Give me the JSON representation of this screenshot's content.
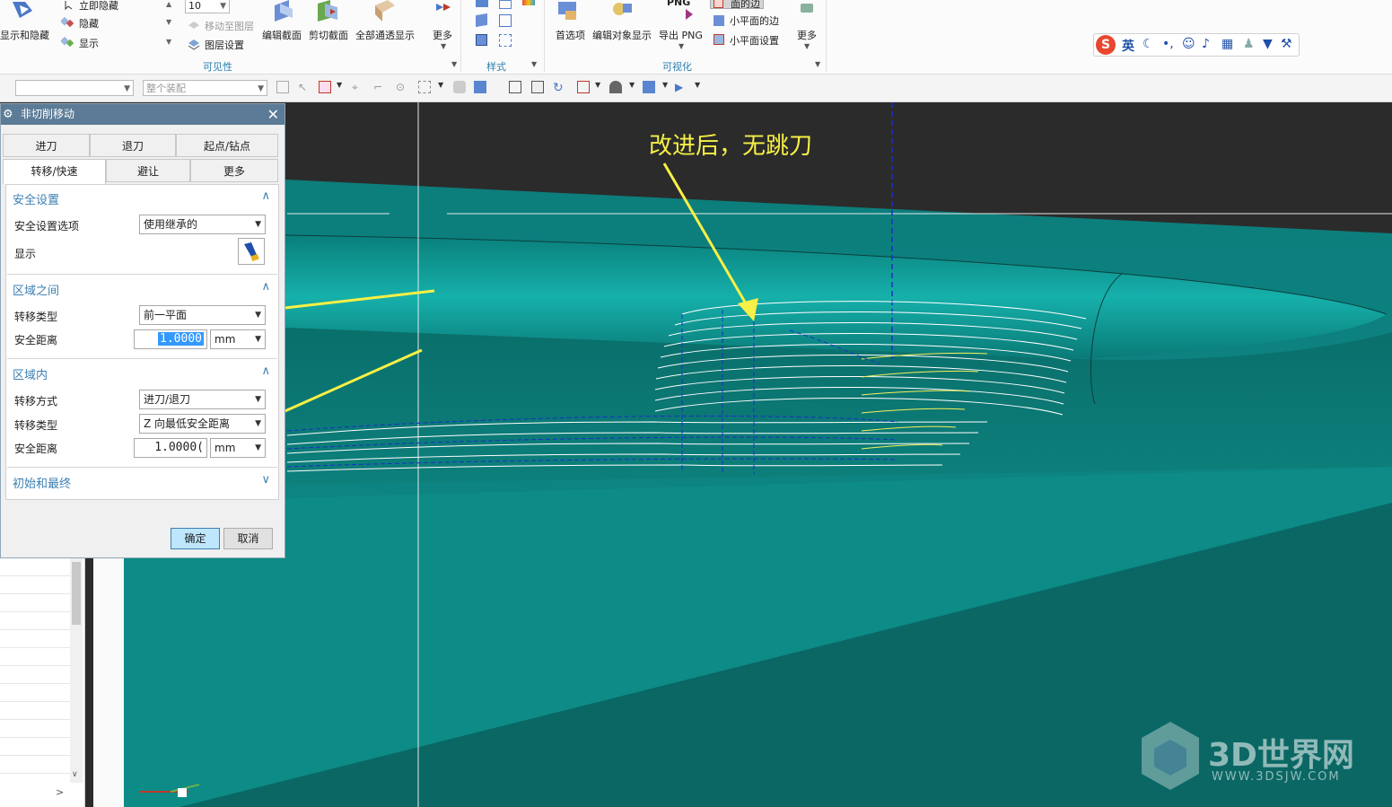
{
  "ribbon": {
    "show_hide": "显示和隐藏",
    "immediate_hide": "立即隐藏",
    "hide": "隐藏",
    "show": "显示",
    "layer_value": "10",
    "move_to_layer": "移动至图层",
    "layer_settings": "图层设置",
    "edit_section": "编辑截面",
    "clip_section": "剪切截面",
    "all_through_display": "全部通透显示",
    "more": "更多",
    "visibility_group": "可见性",
    "style_group": "样式",
    "preferences": "首选项",
    "edit_object_display": "编辑对象显示",
    "export_png": "导出 PNG",
    "png_label": "PNG",
    "face_edges": "面的边",
    "facet_edges": "小平面的边",
    "facet_settings": "小平面设置",
    "visualization_group": "可视化",
    "more2": "更多"
  },
  "toolbar2": {
    "filter_value": "",
    "assembly_scope": "整个装配"
  },
  "dialog": {
    "title": "非切削移动",
    "tabs_row1": [
      "进刀",
      "退刀",
      "起点/钻点"
    ],
    "tabs_row2": [
      "转移/快速",
      "避让",
      "更多"
    ],
    "safety": {
      "header": "安全设置",
      "option_label": "安全设置选项",
      "option_value": "使用继承的",
      "display_label": "显示"
    },
    "between_regions": {
      "header": "区域之间",
      "transfer_type_label": "转移类型",
      "transfer_type_value": "前一平面",
      "safe_distance_label": "安全距离",
      "safe_distance_value": "1.0000",
      "unit": "mm"
    },
    "within_region": {
      "header": "区域内",
      "transfer_mode_label": "转移方式",
      "transfer_mode_value": "进刀/退刀",
      "transfer_type_label": "转移类型",
      "transfer_type_value": "Z 向最低安全距离",
      "safe_distance_label": "安全距离",
      "safe_distance_value": "1.0000(",
      "unit": "mm"
    },
    "initial_final": {
      "header": "初始和最终"
    },
    "ok": "确定",
    "cancel": "取消"
  },
  "annotation": "改进后，无跳刀",
  "ime": {
    "mode": "英"
  },
  "watermark": {
    "brand": "3D世界网",
    "url": "WWW.3DSJW.COM"
  },
  "colors": {
    "model_teal": "#0e8a86",
    "annotation_yellow": "#f7f046",
    "background_dark": "#2b2b2b",
    "dialog_title": "#5b7b96",
    "section_blue": "#3c7fb1"
  }
}
